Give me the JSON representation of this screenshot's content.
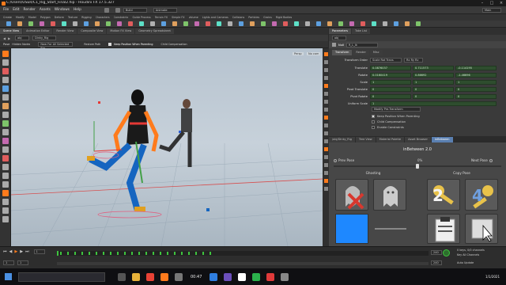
{
  "window": {
    "title": "C:/Users/USER/C1_Rig_Start_Final2.hip - Houdini FX 17.5.327",
    "mode": "Main"
  },
  "menu": [
    "File",
    "Edit",
    "Render",
    "Assets",
    "Windows",
    "Help"
  ],
  "toolbar": {
    "build_label": "Build",
    "desktop_label": "Animate"
  },
  "shelf_tabs": [
    "Animation Editor",
    "Render View",
    "Composite View",
    "Motion FX View",
    "Geometry Spreadsheet"
  ],
  "shelf_tools": [
    "Create",
    "Modify",
    "Model",
    "Polygon",
    "Deform",
    "Texture",
    "Rigging",
    "Characters",
    "Constraints",
    "Guide Process",
    "Terrain FX",
    "Simple FX",
    "Volume",
    "Lights and Cameras",
    "Collisions",
    "Particles",
    "Grains",
    "Rigid Bodies",
    "Particle Fluids",
    "Viscous Fluids",
    "Oceans",
    "Fluid Containers",
    "Populate Containers",
    "Container Tools",
    "Pyro FX",
    "Sparse Pyro FX",
    "FEM",
    "Wires",
    "Crowds"
  ],
  "viewport": {
    "tab_label": "Scene View",
    "path": "obj",
    "path_node": "Dinky_Rig",
    "mode": "Pose",
    "options": [
      "Hidden Nodes",
      "Now For All Selected Rig",
      "Restore Path",
      "Keep Position When Parenting",
      "Child Compensation"
    ],
    "persp_label": "Persp",
    "cam_label": "No cam"
  },
  "params": {
    "tabs": [
      "Parameters",
      "Take List"
    ],
    "path": "obj",
    "node_type": "Null",
    "node_name": "R_L_Ik",
    "subtabs": [
      "Transform",
      "Render",
      "Misc"
    ],
    "transform_order_label": "Transform Order",
    "transform_order": "Scale Rot Trans",
    "rotate_order": "Rx Ry Rz",
    "rows": [
      {
        "label": "Translate",
        "values": [
          "0.0876037",
          "0.711573",
          "-0.114195"
        ]
      },
      {
        "label": "Rotate",
        "values": [
          "0.0160419",
          "0.86692",
          "-1.46696"
        ]
      },
      {
        "label": "Scale",
        "values": [
          "1",
          "1",
          "1"
        ]
      },
      {
        "label": "Pivot Translate",
        "values": [
          "0",
          "0",
          "0"
        ]
      },
      {
        "label": "Pivot Rotate",
        "values": [
          "0",
          "0",
          "0"
        ]
      },
      {
        "label": "Uniform Scale",
        "values": [
          "1"
        ]
      }
    ],
    "modify_button": "Modify Pre-Transform",
    "checks": [
      {
        "label": "Keep Position When Parenting",
        "checked": true
      },
      {
        "label": "Child Compensation",
        "checked": false
      },
      {
        "label": "Enable Constraints",
        "checked": false
      }
    ]
  },
  "inbetween": {
    "tabs": [
      "/obj/Dinky_Rig",
      "Tree View",
      "Material Palette",
      "Asset Browser",
      "inBetween"
    ],
    "title": "inBetween 2.0",
    "prev": "Prev Pose",
    "next": "Next Pose",
    "percent": "0%",
    "ghosting_label": "Ghosting",
    "copy_pose_label": "Copy Pose",
    "key_left_digit": "2",
    "key_right_digit": "4",
    "swatch_color": "#1e88ff"
  },
  "timeline": {
    "frame": "1",
    "start": "1",
    "end": "240",
    "range_end": "240",
    "keys_label": "0 keys, 0/0 channels",
    "key_all_label": "Key All Channels",
    "auto_update": "Auto Update"
  },
  "taskbar": {
    "time": "00:47",
    "date": "1/1/2021"
  },
  "colors": {
    "accent": "#ff7b1c",
    "green_key": "#3ec43e",
    "grid_red": "#d65050"
  }
}
